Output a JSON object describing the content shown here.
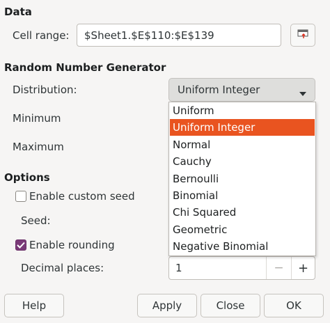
{
  "data_section": {
    "heading": "Data",
    "cell_range_label": "Cell range:",
    "cell_range_value": "$Sheet1.$E$110:$E$139"
  },
  "rng_section": {
    "heading": "Random Number Generator",
    "distribution_label": "Distribution:",
    "distribution_selected": "Uniform Integer",
    "minimum_label": "Minimum",
    "maximum_label": "Maximum",
    "distribution_options": [
      "Uniform",
      "Uniform Integer",
      "Normal",
      "Cauchy",
      "Bernoulli",
      "Binomial",
      "Chi Squared",
      "Geometric",
      "Negative Binomial"
    ]
  },
  "options_section": {
    "heading": "Options",
    "enable_custom_seed_label": "Enable custom seed",
    "enable_custom_seed_checked": false,
    "seed_label": "Seed:",
    "enable_rounding_label": "Enable rounding",
    "enable_rounding_checked": true,
    "decimal_places_label": "Decimal places:",
    "decimal_places_value": "1",
    "minus_label": "−",
    "plus_label": "+"
  },
  "buttons": {
    "help": "Help",
    "apply": "Apply",
    "close": "Close",
    "ok": "OK"
  },
  "colors": {
    "highlight": "#e95420",
    "checkbox_checked": "#7a3a78"
  },
  "icons": {
    "shrink_button": "shrink-dialog-icon",
    "dropdown": "chevron-down-icon"
  }
}
